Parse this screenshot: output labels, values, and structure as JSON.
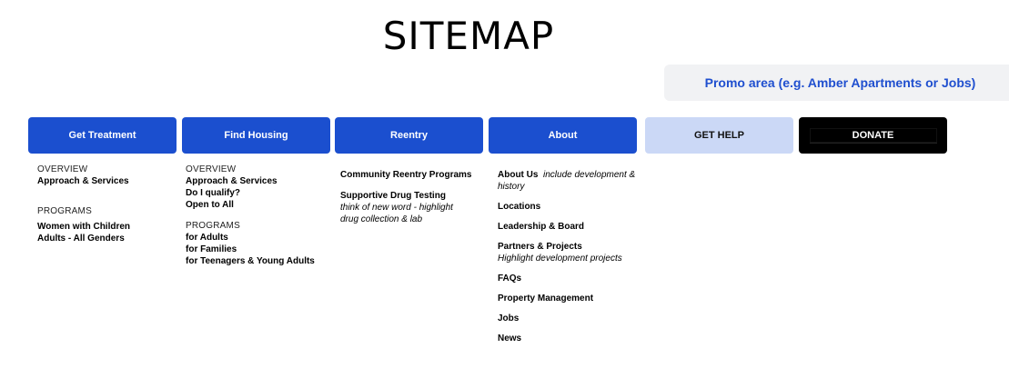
{
  "title": "SITEMAP",
  "promo": "Promo area (e.g. Amber Apartments or Jobs)",
  "nav": {
    "get_treatment": "Get Treatment",
    "find_housing": "Find Housing",
    "reentry": "Reentry",
    "about": "About",
    "get_help": "GET HELP",
    "donate": "DONATE"
  },
  "colors": {
    "nav_blue": "#1b4fcf",
    "get_help_bg": "#cbd8f6",
    "donate_bg": "#000000",
    "promo_text": "#1f4fcf"
  },
  "treatment": {
    "overview_heading": "OVERVIEW",
    "approach": "Approach & Services",
    "programs_heading": "PROGRAMS",
    "women": "Women with Children",
    "adults": "Adults - All Genders"
  },
  "housing": {
    "overview_heading": "OVERVIEW",
    "approach": "Approach & Services",
    "qualify": "Do I qualify?",
    "open": "Open to All",
    "programs_heading": "PROGRAMS",
    "for_adults": "for Adults",
    "for_families": "for Families",
    "for_teens": "for Teenagers & Young Adults"
  },
  "reentry": {
    "community": "Community Reentry Programs",
    "drug_testing": "Supportive Drug Testing",
    "drug_note": "think of new word - highlight drug collection & lab"
  },
  "about": {
    "about_us": "About Us",
    "about_note": "include development & history",
    "locations": "Locations",
    "leadership": "Leadership & Board",
    "partners": "Partners & Projects",
    "partners_note": "Highlight development projects",
    "faqs": "FAQs",
    "property": "Property Management",
    "jobs": "Jobs",
    "news": "News"
  }
}
